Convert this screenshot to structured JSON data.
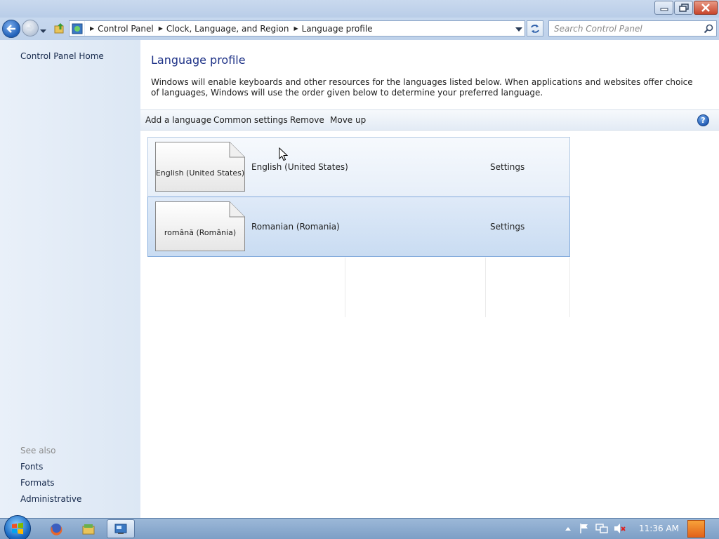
{
  "window": {
    "buttons": [
      "minimize",
      "maximize",
      "close"
    ]
  },
  "address": {
    "crumbs": [
      "Control Panel",
      "Clock, Language, and Region",
      "Language profile"
    ],
    "search_placeholder": "Search Control Panel"
  },
  "sidebar": {
    "home_link": "Control Panel Home",
    "see_also_title": "See also",
    "see_also_links": [
      "Fonts",
      "Formats",
      "Administrative"
    ]
  },
  "page": {
    "title": "Language profile",
    "description": "Windows will enable keyboards and other resources for the languages listed below. When applications and websites offer choice of languages, Windows will use the order given below to determine your preferred language."
  },
  "toolbar": {
    "items": [
      "Add a language",
      "Common settings",
      "Remove",
      "Move up"
    ],
    "help": "?"
  },
  "languages": [
    {
      "native": "English (United States)",
      "name": "English (United States)",
      "settings": "Settings",
      "selected": false
    },
    {
      "native": "română (România)",
      "name": "Romanian (Romania)",
      "settings": "Settings",
      "selected": true
    }
  ],
  "taskbar": {
    "clock": "11:36 AM",
    "apps": [
      "firefox-icon",
      "file-manager-icon",
      "control-panel-icon"
    ]
  },
  "colors": {
    "title_blue": "#1e3287",
    "link_blue": "#15284b",
    "sidebar_bg": "#e4ecf7",
    "selection": "#c9dcf2"
  }
}
